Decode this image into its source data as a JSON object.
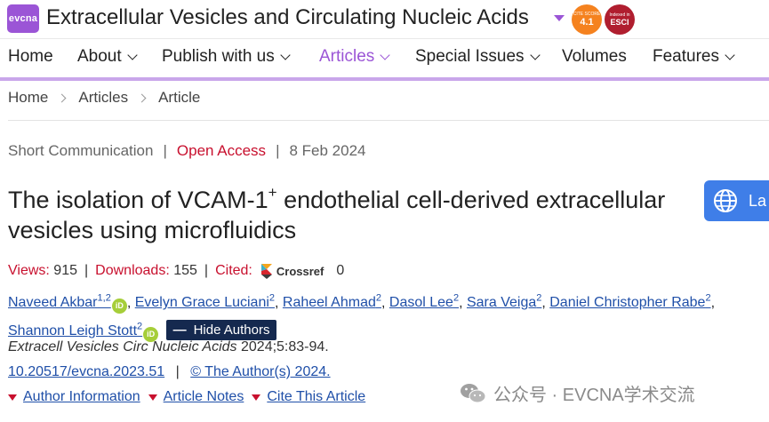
{
  "header": {
    "logo_text": "evcna",
    "journal_title": "Extracellular Vesicles and Circulating Nucleic Acids",
    "cite_badge": {
      "small": "CITE SCORE",
      "value": "4.1"
    },
    "esci_badge": {
      "small": "Indexed in",
      "value": "ESCI"
    }
  },
  "nav": {
    "items": [
      {
        "label": "Home"
      },
      {
        "label": "About"
      },
      {
        "label": "Publish with us"
      },
      {
        "label": "Articles"
      },
      {
        "label": "Special Issues"
      },
      {
        "label": "Volumes"
      },
      {
        "label": "Features"
      }
    ]
  },
  "breadcrumb": [
    "Home",
    "Articles",
    "Article"
  ],
  "article": {
    "type": "Short Communication",
    "access": "Open Access",
    "date": "8 Feb 2024",
    "title_part1": "The isolation of VCAM-1",
    "title_sup": "+",
    "title_part2": " endothelial cell-derived extracellular vesicles using microfluidics",
    "stats": {
      "views_label": "Views:",
      "views": "915",
      "downloads_label": "Downloads:",
      "downloads": "155",
      "cited_label": "Cited:",
      "crossref": "Crossref",
      "cited": "0"
    },
    "authors": [
      {
        "name": "Naveed Akbar",
        "sup": "1,2"
      },
      {
        "name": "Evelyn Grace Luciani",
        "sup": "2"
      },
      {
        "name": "Raheel Ahmad",
        "sup": "2"
      },
      {
        "name": "Dasol Lee",
        "sup": "2"
      },
      {
        "name": "Sara Veiga",
        "sup": "2"
      },
      {
        "name": "Daniel Christopher Rabe",
        "sup": "2"
      },
      {
        "name": "Shannon Leigh Stott",
        "sup": "2"
      }
    ],
    "orcid_label": "iD",
    "hide_authors": "Hide Authors",
    "citation_journal": "Extracell Vesicles Circ Nucleic Acids",
    "citation_rest": " 2024;5:83-94.",
    "doi": "10.20517/evcna.2023.51",
    "license": "© The Author(s) 2024.",
    "toggles": [
      "Author Information",
      "Article Notes",
      "Cite This Article"
    ]
  },
  "lang_button": {
    "label": "La"
  },
  "watermark": "公众号 · EVCNA学术交流",
  "colors": {
    "brand_purple": "#9b55d6",
    "nav_rule": "#c9a6ea",
    "link_blue": "#1f4fa8",
    "accent_red": "#c8102e",
    "hide_button": "#15294f",
    "lang_button": "#3f7ee8"
  }
}
